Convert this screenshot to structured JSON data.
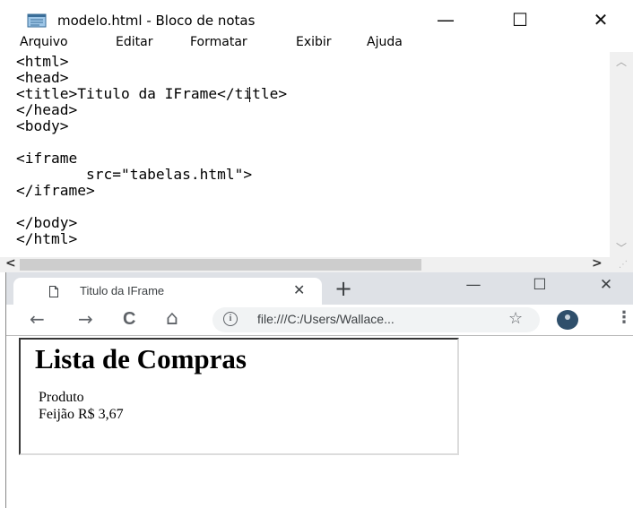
{
  "notepad": {
    "title": "modelo.html - Bloco de notas",
    "controls": {
      "minimize": "—",
      "maximize": "☐",
      "close": "✕"
    },
    "menu": [
      "Arquivo",
      "Editar",
      "Formatar",
      "Exibir",
      "Ajuda"
    ],
    "code_lines": [
      "<html>",
      "<head>",
      "<title>Titulo da IFrame</title>",
      "</head>",
      "<body>",
      "",
      "<iframe",
      "        src=\"tabelas.html\">",
      "</iframe>",
      "",
      "</body>",
      "</html>"
    ],
    "scroll_left": "<",
    "scroll_right": ">"
  },
  "browser": {
    "tab_title": "Titulo da IFrame",
    "tab_close": "✕",
    "new_tab": "+",
    "controls": {
      "minimize": "—",
      "maximize": "☐",
      "close": "✕"
    },
    "nav": {
      "back": "←",
      "forward": "→",
      "reload": "C",
      "home": "⌂"
    },
    "url": "file:///C:/Users/Wallace...",
    "info_glyph": "i",
    "star": "☆",
    "menu": "⋮",
    "iframe": {
      "heading": "Lista de Compras",
      "rows": [
        "Produto",
        "Feijão    R$ 3,67"
      ]
    }
  }
}
